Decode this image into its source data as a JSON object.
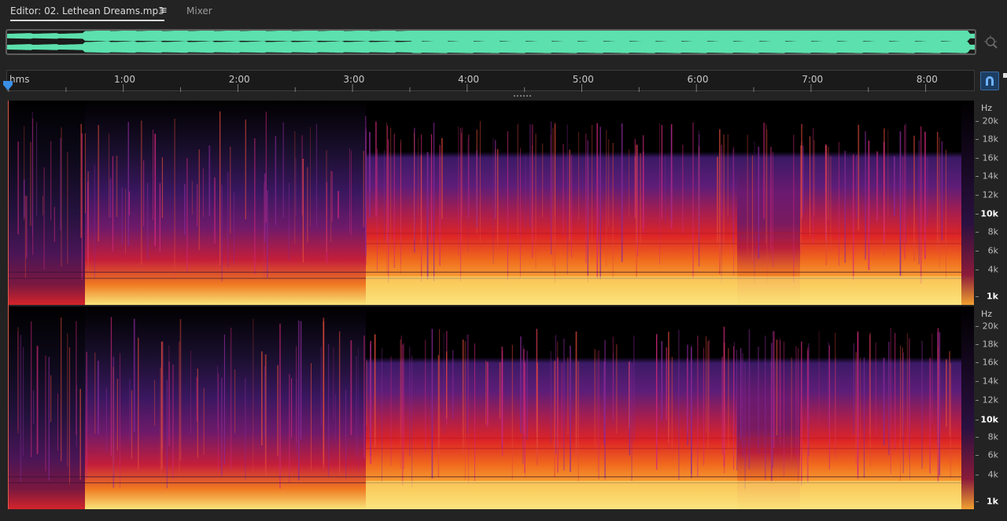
{
  "tabs": {
    "editor_label": "Editor: 02. Lethean Dreams.mp3",
    "mixer_label": "Mixer",
    "menu_icon": "hamburger-icon"
  },
  "ruler": {
    "unit_label": "hms",
    "time_labels": [
      "1:00",
      "2:00",
      "3:00",
      "4:00",
      "5:00",
      "6:00",
      "7:00",
      "8:00"
    ]
  },
  "frequency_scale": {
    "unit": "Hz",
    "labels": [
      "20k",
      "18k",
      "16k",
      "14k",
      "12k",
      "10k",
      "8k",
      "6k",
      "4k",
      "1k"
    ],
    "bold_labels": [
      "10k",
      "1k"
    ]
  },
  "colors": {
    "waveform": "#5ce0ad",
    "spectrogram_low": "#f6e37a",
    "spectrogram_mid": "#e0202a",
    "spectrogram_high": "#5a1a78",
    "background": "#232323",
    "accent": "#3a8fe6"
  },
  "icons": {
    "zoom": "zoom-magnifier-icon",
    "snap": "snap-magnet-icon",
    "playhead": "playhead-marker-icon"
  }
}
